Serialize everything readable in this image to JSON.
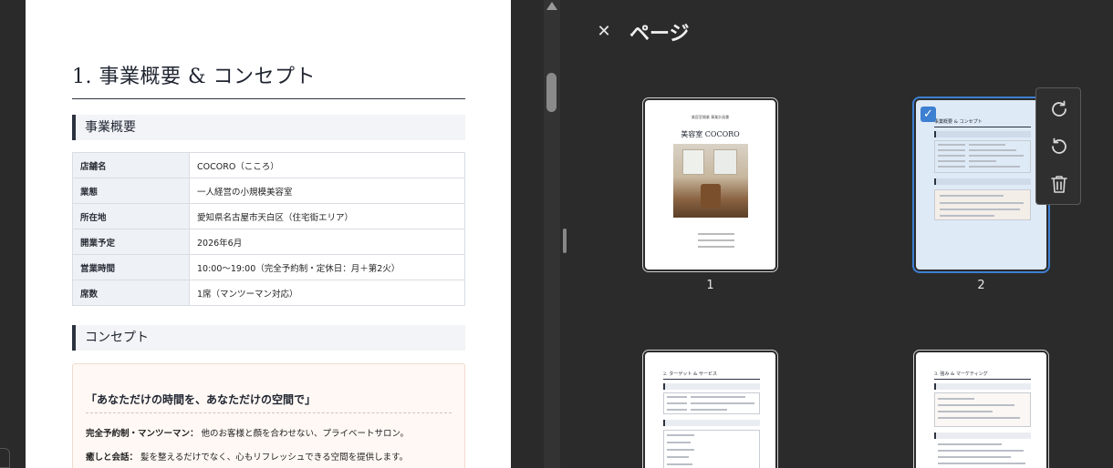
{
  "document": {
    "title": "1. 事業概要 & コンセプト",
    "section_overview": "事業概要",
    "overview_rows": [
      {
        "key": "店舗名",
        "value": "COCORO（こころ）"
      },
      {
        "key": "業態",
        "value": "一人経営の小規模美容室"
      },
      {
        "key": "所在地",
        "value": "愛知県名古屋市天白区（住宅街エリア）"
      },
      {
        "key": "開業予定",
        "value": "2026年6月"
      },
      {
        "key": "営業時間",
        "value": "10:00〜19:00（完全予約制・定休日：月＋第2火）"
      },
      {
        "key": "席数",
        "value": "1席（マンツーマン対応）"
      }
    ],
    "section_concept": "コンセプト",
    "concept_catch": "「あなただけの時間を、あなただけの空間で」",
    "concept_items": [
      {
        "label": "完全予約制・マンツーマン：",
        "text": "他のお客様と顔を合わせない、プライベートサロン。"
      },
      {
        "label": "癒しと会話：",
        "text": "髪を整えるだけでなく、心もリフレッシュできる空間を提供します。"
      }
    ]
  },
  "panel": {
    "close_icon": "close-icon",
    "title": "ページ",
    "pages": [
      {
        "number": "1",
        "selected": false,
        "subtitle": "美容室開業 事業計画書",
        "title": "美容室 COCORO"
      },
      {
        "number": "2",
        "selected": true,
        "heading": "事業概要 & コンセプト"
      },
      {
        "number": "",
        "selected": false,
        "heading": "2. ターゲット & サービス"
      },
      {
        "number": "",
        "selected": false,
        "heading": "3. 強み & マーケティング"
      }
    ],
    "toolbar": {
      "rotate_clockwise_icon": "rotate-clockwise-icon",
      "rotate_counterclockwise_icon": "rotate-counterclockwise-icon",
      "delete_icon": "trash-icon"
    }
  },
  "colors": {
    "accent": "#3d7fd1",
    "panel_bg": "#2b2b2b",
    "heading_bar": "#2b3340"
  }
}
